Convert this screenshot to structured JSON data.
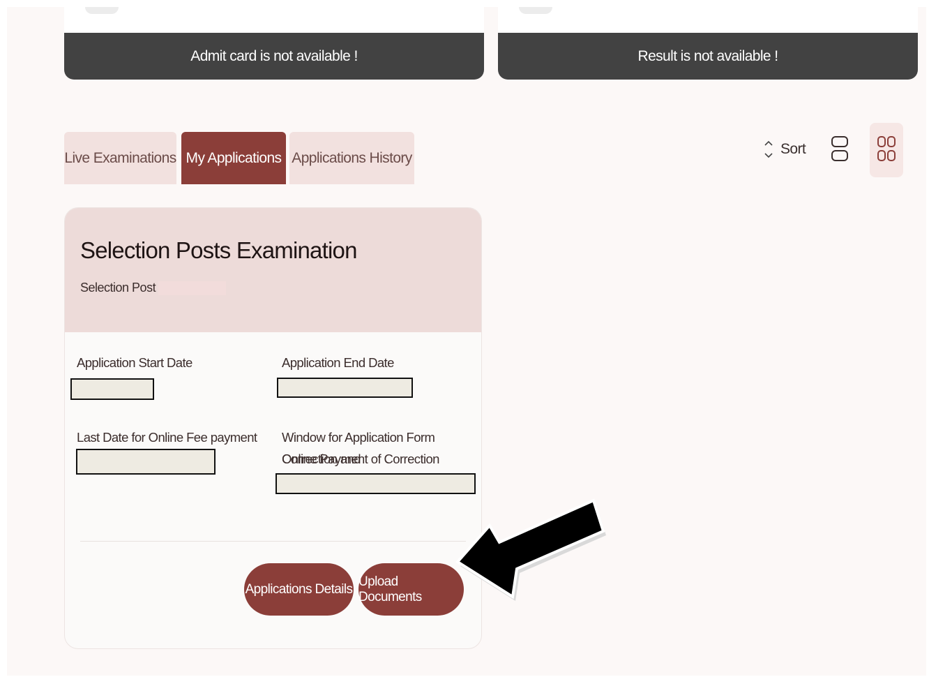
{
  "cards": {
    "admit_card": "Admit card is not available !",
    "result": "Result is not available !"
  },
  "tabs": [
    {
      "label": "Live Examinations"
    },
    {
      "label": "My Applications"
    },
    {
      "label": "Applications History"
    }
  ],
  "sort": {
    "label": "Sort"
  },
  "application": {
    "title": "Selection Posts Examination",
    "subtitle": "Selection Post",
    "fields": {
      "start_date_label": "Application Start Date",
      "end_date_label": "Application End Date",
      "fee_label": "Last Date for Online Fee payment",
      "window_label_line1": "Window for Application Form Correction and",
      "window_label_line2": "Online Payment of Correction Changes"
    },
    "buttons": {
      "details": "Applications Details",
      "upload": "Upload Documents"
    }
  },
  "colors": {
    "accent": "#8b3e39",
    "tab_bg": "#f2e1df",
    "banner": "#424242",
    "card_head": "#eddbd9"
  },
  "icons": [
    "sort-icon",
    "list-view-icon",
    "grid-view-icon",
    "pointer-arrow-icon"
  ]
}
